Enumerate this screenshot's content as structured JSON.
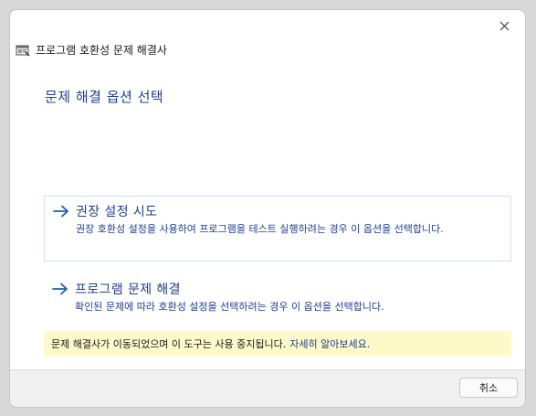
{
  "window": {
    "title": "프로그램 호환성 문제 해결사",
    "close_icon": "close-icon",
    "app_icon": "compatibility-troubleshooter-icon"
  },
  "heading": "문제 해결 옵션 선택",
  "options": [
    {
      "title": "권장 설정 시도",
      "description": "권장 호환성 설정을 사용하여 프로그램을 테스트 실행하려는 경우 이 옵션을 선택합니다.",
      "icon": "arrow-right-icon"
    },
    {
      "title": "프로그램 문제 해결",
      "description": "확인된 문제에 따라 호환성 설정을 선택하려는 경우 이 옵션을 선택합니다.",
      "icon": "arrow-right-icon"
    }
  ],
  "notice": {
    "text": "문제 해결사가 이동되었으며 이 도구는 사용 중지됩니다.",
    "link": "자세히 알아보세요."
  },
  "footer": {
    "cancel_label": "취소"
  },
  "colors": {
    "accent_text": "#1f3f8f",
    "arrow": "#1a5fb4",
    "notice_bg": "#fdf9c9",
    "option_border": "#cfe0f4",
    "footer_bg": "#f0f0f0"
  }
}
